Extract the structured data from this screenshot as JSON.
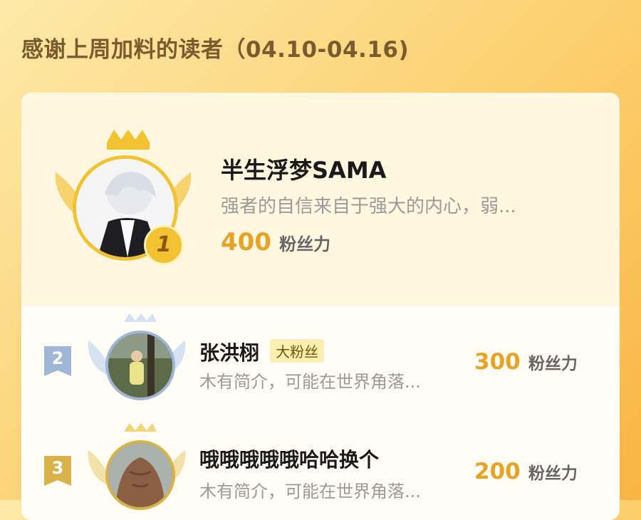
{
  "header": {
    "title": "感谢上周加料的读者（04.10-04.16)"
  },
  "readers": [
    {
      "rank": "1",
      "name": "半生浮梦SAMA",
      "bio": "强者的自信来自于强大的内心，弱...",
      "points": "400",
      "unit": "粉丝力",
      "badge": ""
    },
    {
      "rank": "2",
      "name": "张洪栩",
      "bio": "木有简介，可能在世界角落...",
      "points": "300",
      "unit": "粉丝力",
      "badge": "大粉丝"
    },
    {
      "rank": "3",
      "name": "哦哦哦哦哦哈哈换个",
      "bio": "木有简介，可能在世界角落...",
      "points": "200",
      "unit": "粉丝力",
      "badge": ""
    }
  ],
  "colors": {
    "accent": "#e8a325",
    "gold": "#f2c230",
    "silver": "#9fb6d6",
    "bronze": "#d9b34a"
  }
}
